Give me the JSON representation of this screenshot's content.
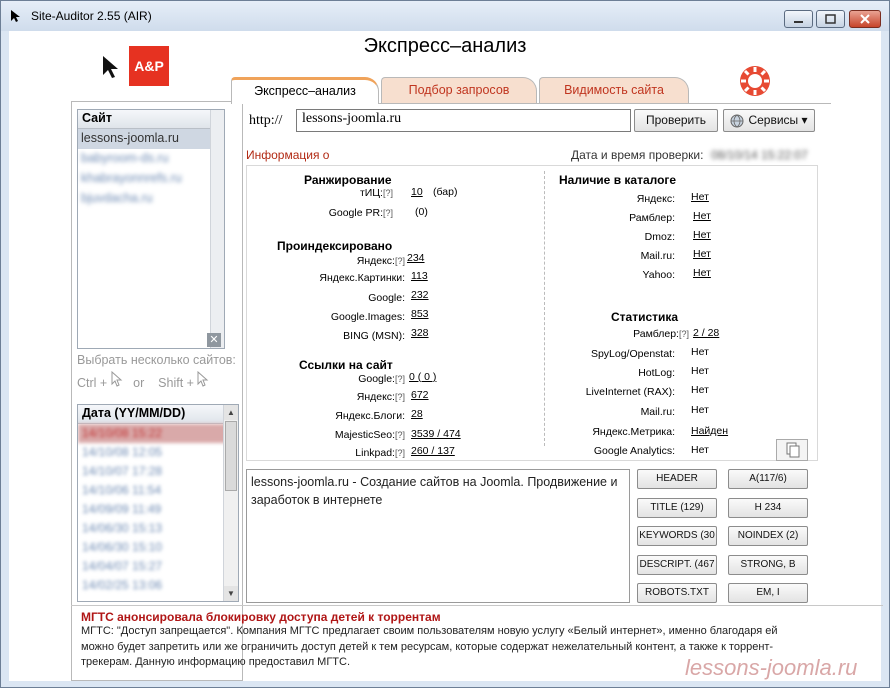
{
  "window": {
    "title": "Site-Auditor 2.55 (AIR)"
  },
  "header": {
    "title": "Экспресс–анализ",
    "logo_text": "A&P"
  },
  "tabs": [
    {
      "label": "Экспресс–анализ",
      "active": true
    },
    {
      "label": "Подбор запросов",
      "active": false
    },
    {
      "label": "Видимость сайта",
      "active": false
    }
  ],
  "sites": {
    "header": "Сайт",
    "items": [
      "lessons-joomla.ru",
      "babyroom-ds.ru",
      "khabrayonnrefs.ru",
      "bjuvdacha.ru"
    ]
  },
  "hints": {
    "multi_select": "Выбрать несколько сайтов:",
    "ctrl": "Ctrl +",
    "or": "or",
    "shift": "Shift +"
  },
  "dates": {
    "header": "Дата (YY/MM/DD)",
    "items": [
      "14/10/08 15:22",
      "14/10/08 12:05",
      "14/10/07 17:28",
      "14/10/06 11:54",
      "14/09/09 11:49",
      "14/06/30 15:13",
      "14/06/30 15:10",
      "14/04/07 15:27",
      "14/02/25 13:06"
    ]
  },
  "urlbar": {
    "protocol": "http://",
    "value": "lessons-joomla.ru",
    "check_button": "Проверить",
    "services_button": "Сервисы ▾"
  },
  "info": {
    "label": "Информация о",
    "date_label": "Дата и время проверки:",
    "date_value": "08/10/14 15:22:07"
  },
  "ranking": {
    "title": "Ранжирование",
    "tic_label": "тИЦ:",
    "tic_value": "10",
    "tic_unit": "(бар)",
    "pr_label": "Google PR:",
    "pr_value": "(0)"
  },
  "indexed": {
    "title": "Проиндексировано",
    "rows": [
      {
        "label": "Яндекс:",
        "q": "[?]",
        "value": "234"
      },
      {
        "label": "Яндекс.Картинки:",
        "q": "",
        "value": "113"
      },
      {
        "label": "Google:",
        "q": "",
        "value": "232"
      },
      {
        "label": "Google.Images:",
        "q": "",
        "value": "853"
      },
      {
        "label": "BING (MSN):",
        "q": "",
        "value": "328"
      }
    ]
  },
  "links": {
    "title": "Ссылки на сайт",
    "rows": [
      {
        "label": "Google:",
        "q": "[?]",
        "value": "0  ( 0 )"
      },
      {
        "label": "Яндекс:",
        "q": "[?]",
        "value": "672"
      },
      {
        "label": "Яндекс.Блоги:",
        "q": "",
        "value": "28"
      },
      {
        "label": "MajesticSeo:",
        "q": "[?]",
        "value": "3539 / 474"
      },
      {
        "label": "Linkpad:",
        "q": "[?]",
        "value": "260 / 137"
      }
    ]
  },
  "catalogs": {
    "title": "Наличие в каталоге",
    "rows": [
      {
        "label": "Яндекс:",
        "value": "Нет"
      },
      {
        "label": "Рамблер:",
        "value": "Нет"
      },
      {
        "label": "Dmoz:",
        "value": "Нет"
      },
      {
        "label": "Mail.ru:",
        "value": "Нет"
      },
      {
        "label": "Yahoo:",
        "value": "Нет"
      }
    ]
  },
  "stats": {
    "title": "Статистика",
    "rows": [
      {
        "label": "Рамблер:",
        "q": "[?]",
        "value": "2 / 28"
      },
      {
        "label": "SpyLog/Openstat:",
        "q": "",
        "value": "Нет"
      },
      {
        "label": "HotLog:",
        "q": "",
        "value": "Нет"
      },
      {
        "label": "LiveInternet (RAX):",
        "q": "",
        "value": "Нет"
      },
      {
        "label": "Mail.ru:",
        "q": "",
        "value": "Нет"
      },
      {
        "label": "Яндекс.Метрика:",
        "q": "",
        "value": "Найден"
      },
      {
        "label": "Google Analytics:",
        "q": "",
        "value": "Нет"
      }
    ]
  },
  "description": "lessons-joomla.ru - Создание сайтов на Joomla. Продвижение и заработок в интернете",
  "tag_buttons": [
    "HEADER",
    "A(117/6)",
    "TITLE (129)",
    "H 234",
    "KEYWORDS (30",
    "NOINDEX  (2)",
    "DESCRIPT. (467",
    "STRONG, B",
    "ROBOTS.TXT",
    "EM, I"
  ],
  "news": {
    "title": "МГТС анонсировала блокировку доступа детей к торрентам",
    "text": "МГТС: \"Доступ запрещается\". Компания МГТС предлагает своим пользователям новую услугу «Белый интернет», именно благодаря ей можно будет запретить или же ограничить доступ детей к тем ресурсам, которые содержат нежелательный контент, а также к торрент-трекерам. Данную информацию предоставил МГТС."
  },
  "watermark": "lessons-joomla.ru"
}
